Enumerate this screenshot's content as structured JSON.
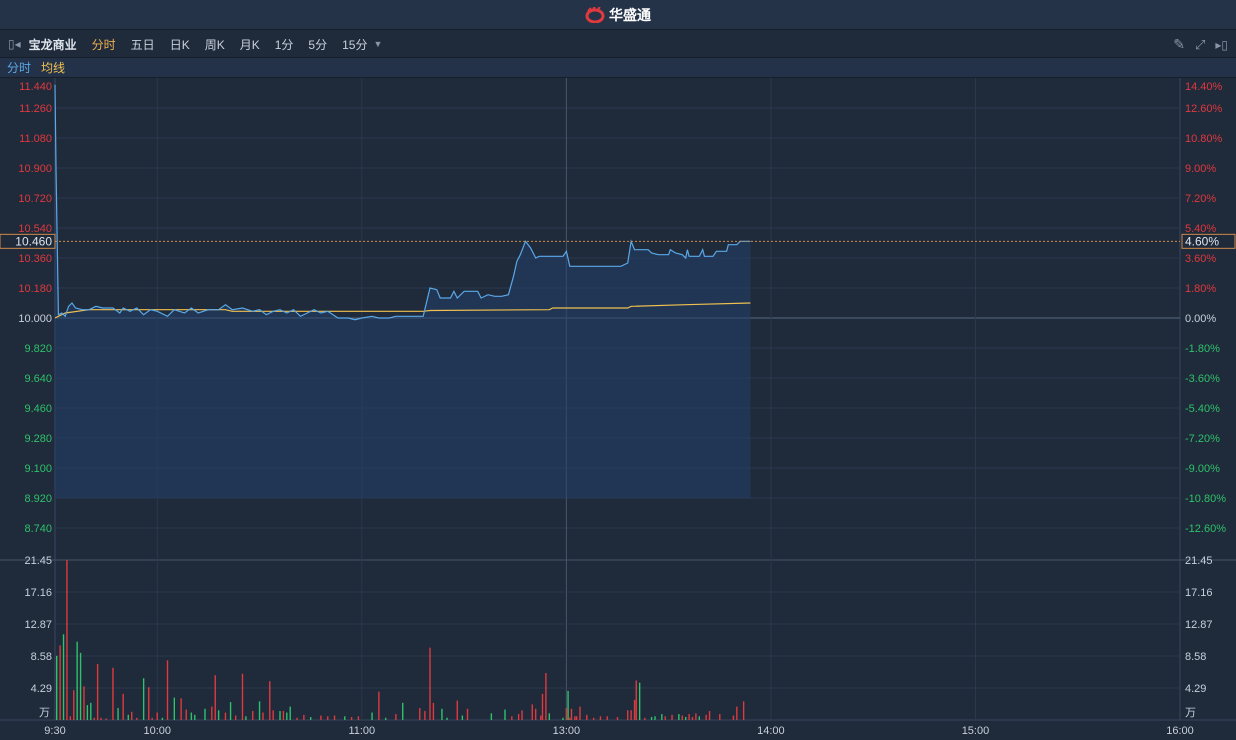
{
  "app": {
    "logo_text": "华盛通"
  },
  "toolbar": {
    "stock_name": "宝龙商业",
    "tabs": [
      "分时",
      "五日",
      "日K",
      "周K",
      "月K",
      "1分",
      "5分",
      "15分"
    ],
    "active_tab": "分时"
  },
  "legend": {
    "price": "分时",
    "avg": "均线"
  },
  "colors": {
    "up": "#e0393e",
    "down": "#2ec26a",
    "price_line": "#5aa8e8",
    "avg_line": "#f0c050",
    "bg": "#1f2a3a"
  },
  "chart_data": {
    "type": "line",
    "title": "宝龙商业 分时",
    "prev_close": 10.0,
    "current_price": "10.460",
    "current_pct": "4.60%",
    "price_ticks": [
      "11.440",
      "11.260",
      "11.080",
      "10.900",
      "10.720",
      "10.540",
      "10.360",
      "10.180",
      "10.000",
      "9.820",
      "9.640",
      "9.460",
      "9.280",
      "9.100",
      "8.920",
      "8.740"
    ],
    "pct_ticks": [
      "14.40%",
      "12.60%",
      "10.80%",
      "9.00%",
      "7.20%",
      "5.40%",
      "3.60%",
      "1.80%",
      "0.00%",
      "-1.80%",
      "-3.60%",
      "-5.40%",
      "-7.20%",
      "-9.00%",
      "-10.80%",
      "-12.60%"
    ],
    "ylim": [
      8.56,
      11.44
    ],
    "x_labels": [
      "9:30",
      "10:00",
      "11:00",
      "13:00",
      "14:00",
      "15:00",
      "16:00"
    ],
    "x_label_minutes": [
      0,
      30,
      90,
      150,
      210,
      270,
      330
    ],
    "total_minutes": 330,
    "price_series": [
      [
        0,
        11.4
      ],
      [
        0.3,
        10.9
      ],
      [
        1,
        10.02
      ],
      [
        2,
        10.03
      ],
      [
        3,
        10.01
      ],
      [
        4,
        10.07
      ],
      [
        5,
        10.09
      ],
      [
        6,
        10.06
      ],
      [
        8,
        10.05
      ],
      [
        10,
        10.05
      ],
      [
        12,
        10.07
      ],
      [
        14,
        10.06
      ],
      [
        17,
        10.06
      ],
      [
        19,
        10.03
      ],
      [
        20,
        10.06
      ],
      [
        22,
        10.04
      ],
      [
        24,
        10.06
      ],
      [
        26,
        10.02
      ],
      [
        28,
        10.05
      ],
      [
        30,
        10.04
      ],
      [
        33,
        10.01
      ],
      [
        35,
        10.05
      ],
      [
        38,
        10.03
      ],
      [
        40,
        10.06
      ],
      [
        42,
        10.03
      ],
      [
        45,
        10.05
      ],
      [
        48,
        10.05
      ],
      [
        50,
        10.08
      ],
      [
        52,
        10.05
      ],
      [
        55,
        10.06
      ],
      [
        58,
        10.04
      ],
      [
        60,
        10.05
      ],
      [
        62,
        10.02
      ],
      [
        64,
        10.04
      ],
      [
        66,
        10.05
      ],
      [
        68,
        10.03
      ],
      [
        70,
        10.05
      ],
      [
        72,
        10.01
      ],
      [
        74,
        10.03
      ],
      [
        76,
        10.05
      ],
      [
        78,
        10.03
      ],
      [
        80,
        10.04
      ],
      [
        83,
        10.0
      ],
      [
        86,
        10.0
      ],
      [
        88,
        9.99
      ],
      [
        90,
        10.0
      ],
      [
        93,
        10.01
      ],
      [
        95,
        10.0
      ],
      [
        98,
        10.0
      ],
      [
        100,
        10.01
      ],
      [
        108,
        10.01
      ],
      [
        110,
        10.18
      ],
      [
        112,
        10.17
      ],
      [
        113,
        10.12
      ],
      [
        116,
        10.12
      ],
      [
        117,
        10.16
      ],
      [
        118,
        10.12
      ],
      [
        120,
        10.16
      ],
      [
        124,
        10.16
      ],
      [
        125,
        10.12
      ],
      [
        127,
        10.14
      ],
      [
        129,
        10.13
      ],
      [
        131,
        10.13
      ],
      [
        133,
        10.14
      ],
      [
        134.5,
        10.25
      ],
      [
        135.5,
        10.34
      ],
      [
        136.5,
        10.38
      ],
      [
        138,
        10.46
      ],
      [
        139.5,
        10.42
      ],
      [
        141,
        10.36
      ],
      [
        142,
        10.37
      ],
      [
        149,
        10.37
      ],
      [
        150,
        10.4
      ],
      [
        151,
        10.31
      ],
      [
        166,
        10.31
      ],
      [
        168,
        10.33
      ],
      [
        169,
        10.46
      ],
      [
        170,
        10.41
      ],
      [
        174,
        10.41
      ],
      [
        175,
        10.39
      ],
      [
        177,
        10.38
      ],
      [
        180,
        10.38
      ],
      [
        180.5,
        10.41
      ],
      [
        182,
        10.39
      ],
      [
        184,
        10.38
      ],
      [
        185,
        10.36
      ],
      [
        185.5,
        10.41
      ],
      [
        186,
        10.37
      ],
      [
        189,
        10.37
      ],
      [
        190,
        10.41
      ],
      [
        190.5,
        10.37
      ],
      [
        193,
        10.37
      ],
      [
        194,
        10.4
      ],
      [
        197,
        10.4
      ],
      [
        197.5,
        10.44
      ],
      [
        200,
        10.44
      ],
      [
        201,
        10.46
      ],
      [
        204,
        10.46
      ]
    ],
    "avg_series": [
      [
        0,
        10.0
      ],
      [
        3,
        10.03
      ],
      [
        10,
        10.05
      ],
      [
        50,
        10.05
      ],
      [
        52,
        10.04
      ],
      [
        108,
        10.04
      ],
      [
        110,
        10.045
      ],
      [
        145,
        10.05
      ],
      [
        146,
        10.06
      ],
      [
        168,
        10.06
      ],
      [
        169,
        10.07
      ],
      [
        185,
        10.08
      ],
      [
        204,
        10.09
      ]
    ],
    "volume_ticks": [
      "21.45",
      "17.16",
      "12.87",
      "8.58",
      "4.29"
    ],
    "volume_unit": "万",
    "volume_max": 21.45,
    "volume_bars": [
      [
        0.5,
        8.6,
        "down"
      ],
      [
        1.5,
        10,
        "up"
      ],
      [
        2.5,
        11.5,
        "down"
      ],
      [
        3.5,
        21.45,
        "up"
      ],
      [
        4.5,
        0.5,
        "up"
      ],
      [
        5.5,
        4,
        "up"
      ],
      [
        6.5,
        10.5,
        "down"
      ],
      [
        7.5,
        9,
        "down"
      ],
      [
        8.5,
        4.5,
        "up"
      ],
      [
        9.5,
        2,
        "down"
      ],
      [
        10.5,
        2.3,
        "down"
      ],
      [
        11.5,
        0.3,
        "up"
      ],
      [
        12.5,
        7.5,
        "up"
      ],
      [
        13.5,
        0.3,
        "up"
      ],
      [
        15,
        0.2,
        "up"
      ],
      [
        17,
        7,
        "up"
      ],
      [
        18.5,
        1.6,
        "down"
      ],
      [
        20,
        3.5,
        "up"
      ],
      [
        21.5,
        0.7,
        "down"
      ],
      [
        22.5,
        1.1,
        "up"
      ],
      [
        24,
        0.3,
        "up"
      ],
      [
        26,
        5.6,
        "down"
      ],
      [
        27.5,
        4.4,
        "up"
      ],
      [
        28.5,
        0.3,
        "up"
      ],
      [
        30,
        1,
        "up"
      ],
      [
        31.5,
        0.3,
        "down"
      ],
      [
        33,
        8,
        "up"
      ],
      [
        35,
        3,
        "down"
      ],
      [
        37,
        2.9,
        "up"
      ],
      [
        38.5,
        1.4,
        "up"
      ],
      [
        40,
        1,
        "down"
      ],
      [
        41,
        0.7,
        "down"
      ],
      [
        44,
        1.5,
        "down"
      ],
      [
        46,
        1.8,
        "up"
      ],
      [
        47,
        6,
        "up"
      ],
      [
        48,
        1.3,
        "down"
      ],
      [
        50,
        1,
        "up"
      ],
      [
        51.5,
        2.4,
        "down"
      ],
      [
        53,
        0.6,
        "up"
      ],
      [
        55,
        6.2,
        "up"
      ],
      [
        56,
        0.5,
        "down"
      ],
      [
        58,
        1.2,
        "up"
      ],
      [
        60,
        2.5,
        "down"
      ],
      [
        61,
        1,
        "up"
      ],
      [
        63,
        5.2,
        "up"
      ],
      [
        64,
        1.3,
        "up"
      ],
      [
        66,
        1.2,
        "down"
      ],
      [
        67,
        1.2,
        "up"
      ],
      [
        68,
        1,
        "down"
      ],
      [
        69,
        1.8,
        "down"
      ],
      [
        71,
        0.3,
        "up"
      ],
      [
        73,
        0.7,
        "up"
      ],
      [
        75,
        0.4,
        "down"
      ],
      [
        78,
        0.6,
        "up"
      ],
      [
        80,
        0.5,
        "up"
      ],
      [
        82,
        0.6,
        "up"
      ],
      [
        85,
        0.5,
        "down"
      ],
      [
        87,
        0.4,
        "up"
      ],
      [
        89,
        0.5,
        "up"
      ],
      [
        93,
        1,
        "down"
      ],
      [
        95,
        3.8,
        "up"
      ],
      [
        97,
        0.3,
        "down"
      ],
      [
        100,
        0.8,
        "up"
      ],
      [
        102,
        2.3,
        "down"
      ],
      [
        107,
        1.6,
        "up"
      ],
      [
        108.5,
        1.2,
        "up"
      ],
      [
        110,
        9.7,
        "up"
      ],
      [
        111,
        2.3,
        "up"
      ],
      [
        113.5,
        1.5,
        "down"
      ],
      [
        115,
        0.3,
        "down"
      ],
      [
        118,
        2.6,
        "up"
      ],
      [
        119.5,
        0.6,
        "down"
      ],
      [
        121,
        1.5,
        "up"
      ],
      [
        128,
        0.9,
        "down"
      ],
      [
        132,
        1.4,
        "down"
      ],
      [
        134,
        0.5,
        "up"
      ],
      [
        136,
        0.8,
        "up"
      ],
      [
        137,
        1.3,
        "up"
      ],
      [
        140,
        2.1,
        "up"
      ],
      [
        141,
        1.5,
        "up"
      ],
      [
        142.5,
        0.6,
        "up"
      ],
      [
        143,
        3.5,
        "up"
      ],
      [
        144,
        6.3,
        "up"
      ],
      [
        145,
        0.9,
        "down"
      ],
      [
        149,
        0.3,
        "down"
      ],
      [
        151.5,
        1.5,
        "up"
      ],
      [
        152.5,
        0.5,
        "up"
      ],
      [
        153,
        0.5,
        "up"
      ],
      [
        154,
        1.8,
        "up"
      ],
      [
        156,
        0.7,
        "up"
      ],
      [
        150,
        1.6,
        "up"
      ],
      [
        150.5,
        3.9,
        "down"
      ],
      [
        151,
        0.3,
        "up"
      ],
      [
        156,
        0.3,
        "up"
      ],
      [
        158,
        0.3,
        "up"
      ],
      [
        160,
        0.5,
        "up"
      ],
      [
        162,
        0.5,
        "up"
      ],
      [
        165,
        0.4,
        "up"
      ],
      [
        168,
        1.3,
        "up"
      ],
      [
        169,
        1.3,
        "up"
      ],
      [
        170,
        2.7,
        "up"
      ],
      [
        170.5,
        5.3,
        "up"
      ],
      [
        171.5,
        5,
        "down"
      ],
      [
        173,
        0.3,
        "up"
      ],
      [
        175,
        0.4,
        "down"
      ],
      [
        176,
        0.5,
        "down"
      ],
      [
        178,
        0.8,
        "down"
      ],
      [
        179,
        0.5,
        "up"
      ],
      [
        181,
        0.7,
        "up"
      ],
      [
        183,
        0.8,
        "down"
      ],
      [
        184,
        0.6,
        "up"
      ],
      [
        185,
        0.4,
        "down"
      ],
      [
        186,
        0.8,
        "up"
      ],
      [
        187,
        0.4,
        "up"
      ],
      [
        188,
        0.9,
        "up"
      ],
      [
        189,
        0.5,
        "down"
      ],
      [
        191,
        0.7,
        "up"
      ],
      [
        192,
        1.2,
        "up"
      ],
      [
        195,
        0.8,
        "up"
      ],
      [
        199,
        0.6,
        "up"
      ],
      [
        200,
        1.8,
        "up"
      ],
      [
        202,
        2.5,
        "up"
      ]
    ]
  }
}
